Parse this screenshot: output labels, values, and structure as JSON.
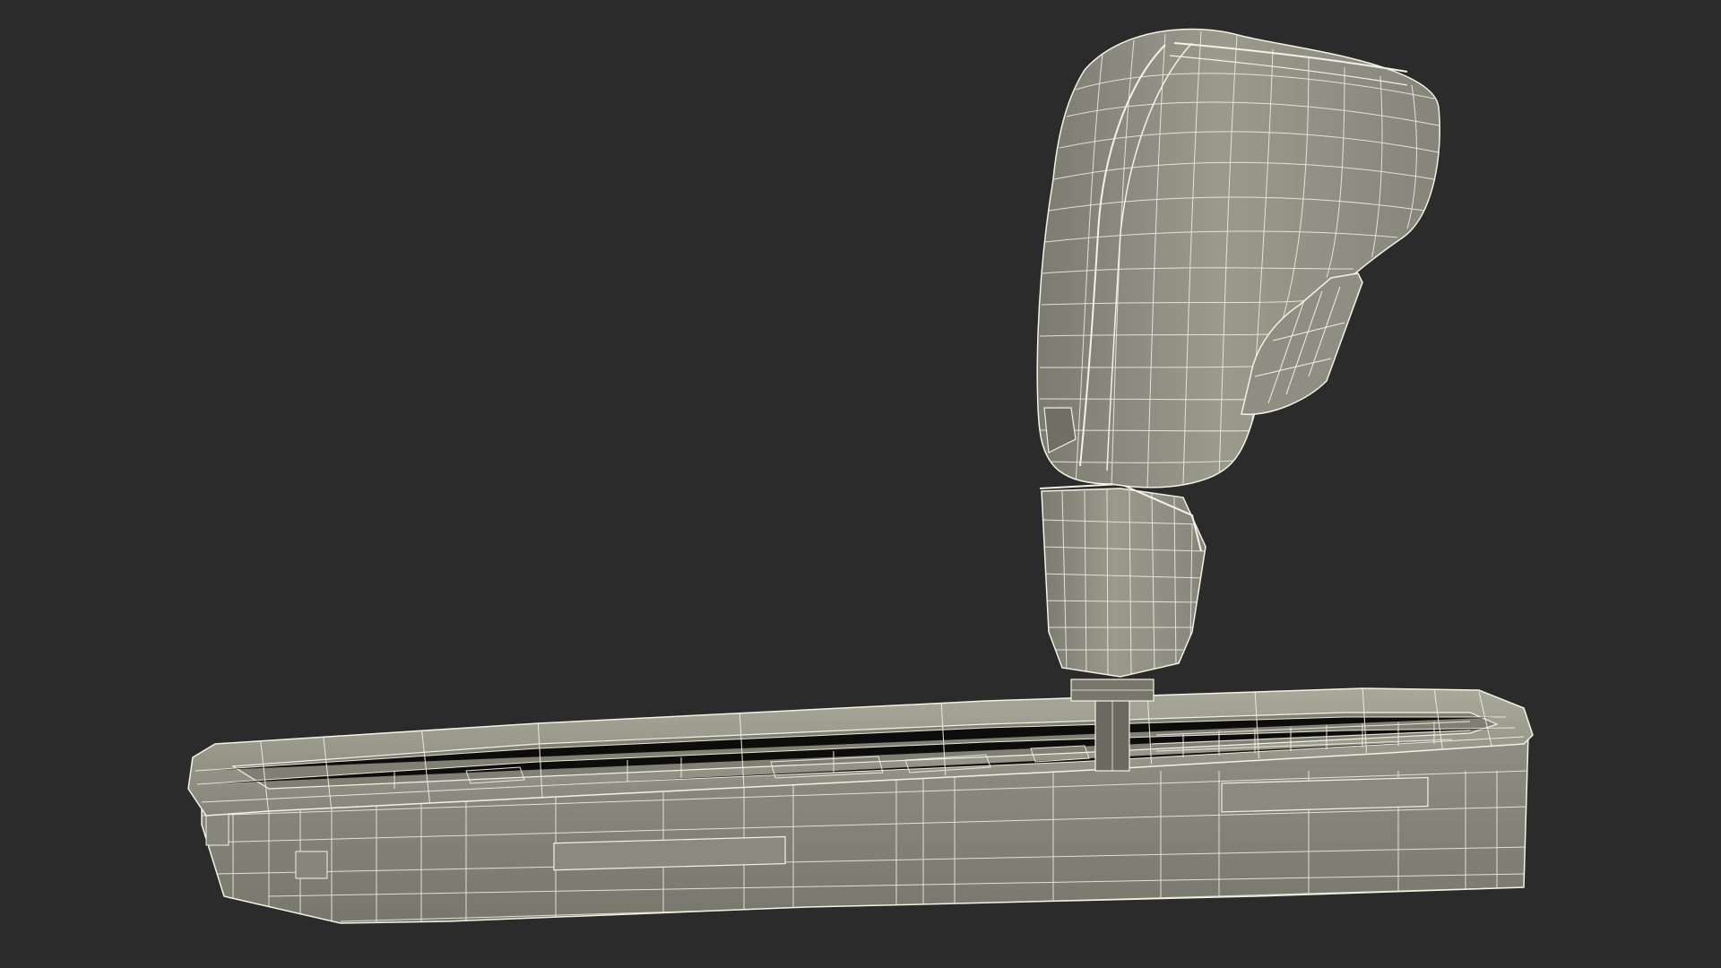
{
  "scene": {
    "background_color": "#2b2b2b",
    "surface_color": "#8c8c80",
    "surface_shadow_color": "#6e6e64",
    "surface_highlight_color": "#a3a396",
    "wire_color": "#f2f2e6"
  }
}
